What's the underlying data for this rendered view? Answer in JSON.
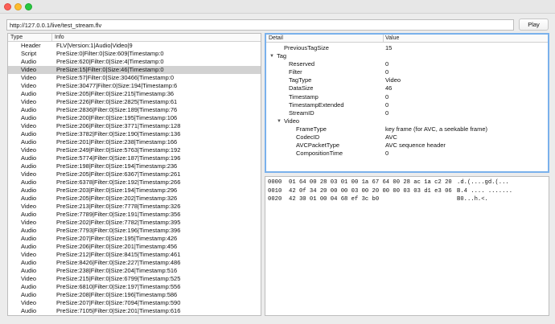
{
  "toolbar": {
    "url_value": "http://127.0.0.1/live/test_stream.flv",
    "play_label": "Play"
  },
  "tag_list": {
    "columns": {
      "type": "Type",
      "info": "Info"
    },
    "selected_index": 3,
    "rows": [
      {
        "type": "Header",
        "info": "FLV|Version:1|Audio|Video|9"
      },
      {
        "type": "Script",
        "info": "PreSize:0|Filter:0|Size:609|Timestamp:0"
      },
      {
        "type": "Audio",
        "info": "PreSize:620|Filter:0|Size:4|Timestamp:0"
      },
      {
        "type": "Video",
        "info": "PreSize:15|Filter:0|Size:46|Timestamp:0"
      },
      {
        "type": "Video",
        "info": "PreSize:57|Filter:0|Size:30466|Timestamp:0"
      },
      {
        "type": "Video",
        "info": "PreSize:30477|Filter:0|Size:194|Timestamp:6"
      },
      {
        "type": "Audio",
        "info": "PreSize:205|Filter:0|Size:215|Timestamp:36"
      },
      {
        "type": "Video",
        "info": "PreSize:226|Filter:0|Size:2825|Timestamp:61"
      },
      {
        "type": "Audio",
        "info": "PreSize:2836|Filter:0|Size:189|Timestamp:76"
      },
      {
        "type": "Audio",
        "info": "PreSize:200|Filter:0|Size:195|Timestamp:106"
      },
      {
        "type": "Video",
        "info": "PreSize:206|Filter:0|Size:3771|Timestamp:128"
      },
      {
        "type": "Audio",
        "info": "PreSize:3782|Filter:0|Size:190|Timestamp:136"
      },
      {
        "type": "Audio",
        "info": "PreSize:201|Filter:0|Size:238|Timestamp:166"
      },
      {
        "type": "Video",
        "info": "PreSize:249|Filter:0|Size:5763|Timestamp:192"
      },
      {
        "type": "Audio",
        "info": "PreSize:5774|Filter:0|Size:187|Timestamp:196"
      },
      {
        "type": "Audio",
        "info": "PreSize:198|Filter:0|Size:194|Timestamp:236"
      },
      {
        "type": "Video",
        "info": "PreSize:205|Filter:0|Size:6367|Timestamp:261"
      },
      {
        "type": "Audio",
        "info": "PreSize:6378|Filter:0|Size:192|Timestamp:266"
      },
      {
        "type": "Audio",
        "info": "PreSize:203|Filter:0|Size:194|Timestamp:296"
      },
      {
        "type": "Audio",
        "info": "PreSize:205|Filter:0|Size:202|Timestamp:326"
      },
      {
        "type": "Video",
        "info": "PreSize:213|Filter:0|Size:7778|Timestamp:326"
      },
      {
        "type": "Audio",
        "info": "PreSize:7789|Filter:0|Size:191|Timestamp:356"
      },
      {
        "type": "Video",
        "info": "PreSize:202|Filter:0|Size:7782|Timestamp:395"
      },
      {
        "type": "Audio",
        "info": "PreSize:7793|Filter:0|Size:196|Timestamp:396"
      },
      {
        "type": "Audio",
        "info": "PreSize:207|Filter:0|Size:195|Timestamp:426"
      },
      {
        "type": "Audio",
        "info": "PreSize:206|Filter:0|Size:201|Timestamp:456"
      },
      {
        "type": "Video",
        "info": "PreSize:212|Filter:0|Size:8415|Timestamp:461"
      },
      {
        "type": "Audio",
        "info": "PreSize:8426|Filter:0|Size:227|Timestamp:486"
      },
      {
        "type": "Audio",
        "info": "PreSize:238|Filter:0|Size:204|Timestamp:516"
      },
      {
        "type": "Video",
        "info": "PreSize:215|Filter:0|Size:6799|Timestamp:525"
      },
      {
        "type": "Audio",
        "info": "PreSize:6810|Filter:0|Size:197|Timestamp:556"
      },
      {
        "type": "Audio",
        "info": "PreSize:208|Filter:0|Size:196|Timestamp:586"
      },
      {
        "type": "Video",
        "info": "PreSize:207|Filter:0|Size:7094|Timestamp:590"
      },
      {
        "type": "Audio",
        "info": "PreSize:7105|Filter:0|Size:201|Timestamp:616"
      }
    ]
  },
  "detail": {
    "columns": {
      "detail": "Detail",
      "value": "Value"
    },
    "rows": [
      {
        "key": "PreviousTagSize",
        "value": "15",
        "depth": 1,
        "expander": ""
      },
      {
        "key": "Tag",
        "value": "",
        "depth": 0,
        "expander": "▼"
      },
      {
        "key": "Reserved",
        "value": "0",
        "depth": 2,
        "expander": ""
      },
      {
        "key": "Filter",
        "value": "0",
        "depth": 2,
        "expander": ""
      },
      {
        "key": "TagType",
        "value": "Video",
        "depth": 2,
        "expander": ""
      },
      {
        "key": "DataSize",
        "value": "46",
        "depth": 2,
        "expander": ""
      },
      {
        "key": "Timestamp",
        "value": "0",
        "depth": 2,
        "expander": ""
      },
      {
        "key": "TimestampExtended",
        "value": "0",
        "depth": 2,
        "expander": ""
      },
      {
        "key": "StreamID",
        "value": "0",
        "depth": 2,
        "expander": ""
      },
      {
        "key": "Video",
        "value": "",
        "depth": 1,
        "expander": "▼"
      },
      {
        "key": "FrameType",
        "value": "key frame (for AVC, a seekable frame)",
        "depth": 3,
        "expander": ""
      },
      {
        "key": "CodecID",
        "value": "AVC",
        "depth": 3,
        "expander": ""
      },
      {
        "key": "AVCPacketType",
        "value": "AVC sequence header",
        "depth": 3,
        "expander": ""
      },
      {
        "key": "CompositionTime",
        "value": "0",
        "depth": 3,
        "expander": ""
      }
    ]
  },
  "hex": {
    "lines": [
      {
        "addr": "0000",
        "bytes": "01 64 00 28 03 01 00 1a 67 64 00 28 ac 1a c2 20",
        "ascii": ".d.(....gd.(..."
      },
      {
        "addr": "0010",
        "bytes": "42 0f 34 20 00 00 03 00 20 00 00 03 03 d1 e3 06",
        "ascii": "B.4 .... ......."
      },
      {
        "addr": "0020",
        "bytes": "42 30 01 00 04 68 ef 3c b0",
        "ascii": "B0...h.<."
      }
    ]
  }
}
